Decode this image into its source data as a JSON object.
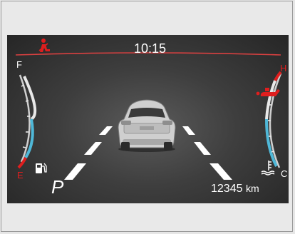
{
  "clock": {
    "time": "10:15"
  },
  "fuel_gauge": {
    "full_label": "F",
    "empty_label": "E",
    "level": 0.0,
    "icon": "fuel-pump-icon"
  },
  "temp_gauge": {
    "hot_label": "H",
    "cold_label": "C",
    "level": 0.0,
    "icon": "coolant-temp-icon"
  },
  "gear": {
    "position": "P"
  },
  "odometer": {
    "value": "12345",
    "unit": "km"
  },
  "indicators": {
    "seatbelt": "seatbelt-warning-icon",
    "oil": "oil-pressure-icon"
  },
  "colors": {
    "warning_red": "#e01e1e",
    "gauge_blue": "#4fb8d8",
    "text_white": "#ffffff"
  }
}
